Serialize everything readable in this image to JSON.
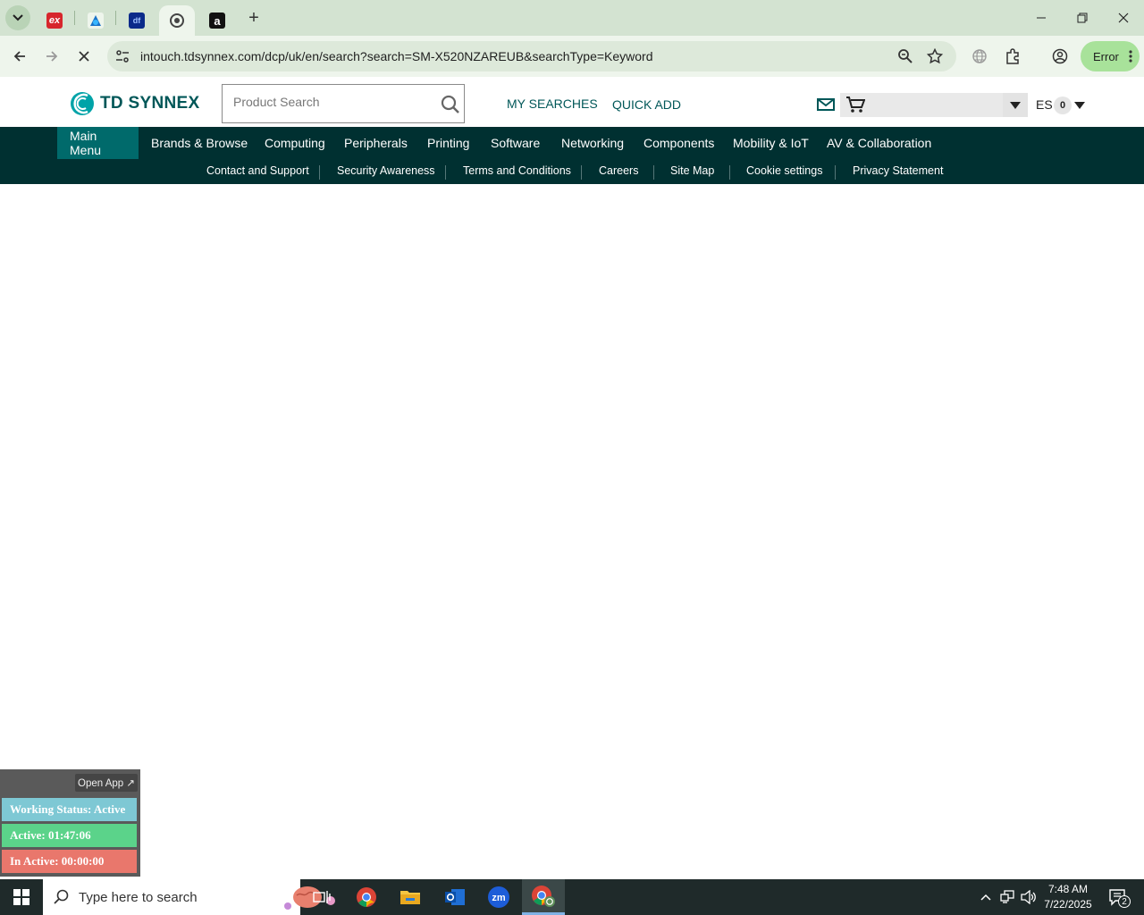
{
  "browser": {
    "tabs": [
      {
        "name": "Ex tab",
        "active": false
      },
      {
        "name": "Blue app tab",
        "active": false
      },
      {
        "name": "DF tab",
        "active": false
      },
      {
        "name": "TD SYNNEX tab",
        "active": true
      },
      {
        "name": "Amazon tab",
        "active": false
      }
    ],
    "url": "intouch.tdsynnex.com/dcp/uk/en/search?search=SM-X520NZAREUB&searchType=Keyword",
    "profile_status": "Error"
  },
  "site": {
    "logo_text": "TD SYNNEX",
    "search_placeholder": "Product Search",
    "my_searches": "MY SEARCHES",
    "quick_add": "QUICK ADD",
    "language": "ES",
    "cart_count": "0"
  },
  "main_nav": [
    "Main Menu",
    "Brands & Browse",
    "Computing",
    "Peripherals",
    "Printing",
    "Software",
    "Networking",
    "Components",
    "Mobility & IoT",
    "AV & Collaboration"
  ],
  "sub_nav": [
    "Contact and Support",
    "Security Awareness",
    "Terms and Conditions",
    "Careers",
    "Site Map",
    "Cookie settings",
    "Privacy Statement"
  ],
  "widget": {
    "open_app": "Open App ↗",
    "working_status": "Working Status: Active",
    "active_time": "Active: 01:47:06",
    "inactive_time": "In Active: 00:00:00",
    "colors": {
      "status": "#7ec8d4",
      "active": "#5bd38a",
      "inactive": "#e9776c"
    }
  },
  "taskbar": {
    "search_placeholder": "Type here to search",
    "time": "7:48 AM",
    "date": "7/22/2025",
    "notifications": "2"
  }
}
